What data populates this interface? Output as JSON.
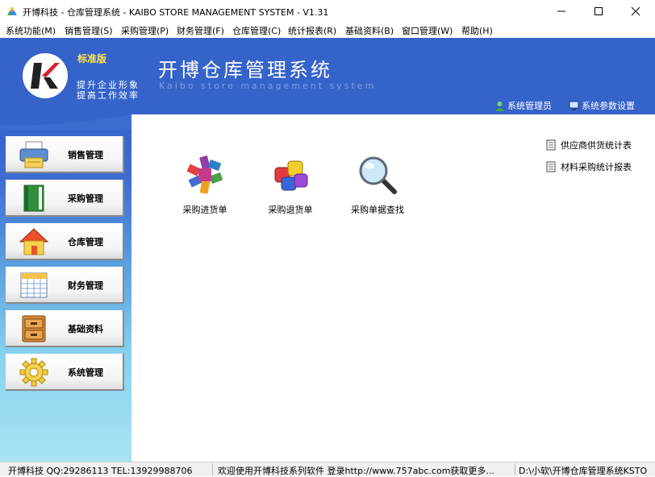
{
  "window": {
    "title": "开博科技 - 仓库管理系统 - KAIBO STORE MANAGEMENT SYSTEM - V1.31",
    "controls": [
      "minimize",
      "maximize",
      "close"
    ]
  },
  "menu": [
    "系统功能(M)",
    "销售管理(S)",
    "采购管理(P)",
    "财务管理(F)",
    "仓库管理(C)",
    "统计报表(R)",
    "基础资料(B)",
    "窗口管理(W)",
    "帮助(H)"
  ],
  "header": {
    "edition": "标准版",
    "slogan_line1": "提升企业形象",
    "slogan_line2": "提高工作效率",
    "title": "开博仓库管理系统",
    "subtitle": "Kaibo store management system",
    "user_link": "系统管理员",
    "settings_link": "系统参数设置"
  },
  "sidebar": [
    {
      "label": "销售管理",
      "icon": "printer-icon"
    },
    {
      "label": "采购管理",
      "icon": "book-icon"
    },
    {
      "label": "仓库管理",
      "icon": "house-icon"
    },
    {
      "label": "财务管理",
      "icon": "calendar-icon"
    },
    {
      "label": "基础资料",
      "icon": "cabinet-icon"
    },
    {
      "label": "系统管理",
      "icon": "gear-icon"
    }
  ],
  "functions": [
    {
      "label": "采购进货单",
      "icon": "color-blocks-icon"
    },
    {
      "label": "采购退货单",
      "icon": "cubes-icon"
    },
    {
      "label": "采购单据查找",
      "icon": "magnifier-icon"
    }
  ],
  "reports": [
    {
      "label": "供应商供货统计表",
      "icon": "document-icon"
    },
    {
      "label": "材料采购统计报表",
      "icon": "document-icon"
    }
  ],
  "status": {
    "company": "开博科技 QQ:29286113 TEL:13929988706",
    "welcome": "欢迎使用开博科技系列软件  登录http://www.757abc.com获取更多...",
    "path": "D:\\小软\\开博仓库管理系统KSTO"
  },
  "colors": {
    "banner": "#3563c9",
    "edition": "#ffe44a",
    "logo_red": "#d8202a"
  }
}
